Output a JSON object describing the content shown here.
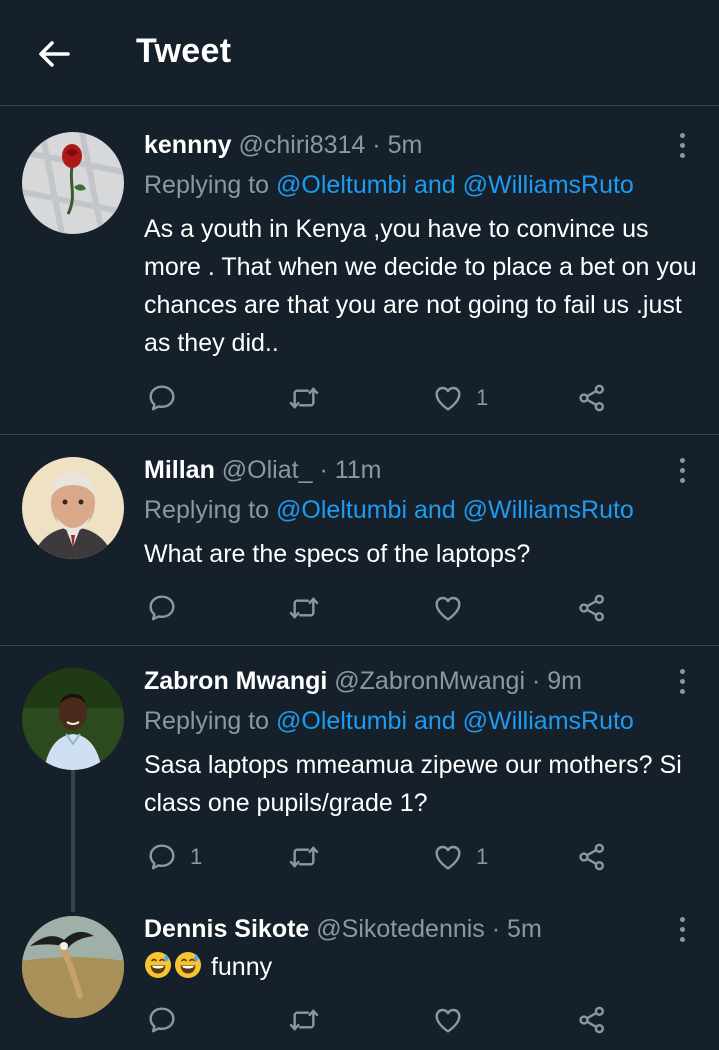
{
  "header": {
    "title": "Tweet"
  },
  "tweets": [
    {
      "name": "kennny",
      "handle": "@chiri8314",
      "time": "5m",
      "replying_prefix": "Replying to ",
      "replying_to": "@Oleltumbi and @WilliamsRuto",
      "text": "As a youth in Kenya ,you have to convince us more . That when we decide to place a bet on you chances are that you are not going to fail us .just as they did..",
      "replies": "",
      "retweets": "",
      "likes": "1"
    },
    {
      "name": "Millan",
      "handle": "@Oliat_",
      "time": "11m",
      "replying_prefix": "Replying to ",
      "replying_to": "@Oleltumbi and @WilliamsRuto",
      "text": "What are the specs of the laptops?",
      "replies": "",
      "retweets": "",
      "likes": ""
    },
    {
      "name": "Zabron Mwangi",
      "handle": "@ZabronMwangi",
      "time": "9m",
      "replying_prefix": "Replying to ",
      "replying_to": "@Oleltumbi and @WilliamsRuto",
      "text": "Sasa laptops mmeamua zipewe our mothers? Si class one pupils/grade 1?",
      "replies": "1",
      "retweets": "",
      "likes": "1"
    },
    {
      "name": "Dennis Sikote",
      "handle": "@Sikotedennis",
      "time": "5m",
      "text": "funny",
      "emoji": [
        "sweat-smile-emoji",
        "sweat-smile-emoji"
      ],
      "replies": "",
      "retweets": "",
      "likes": ""
    }
  ],
  "colors": {
    "background": "#15202b",
    "divider": "#38444d",
    "muted": "#8899a6",
    "link": "#1d9bf0"
  }
}
